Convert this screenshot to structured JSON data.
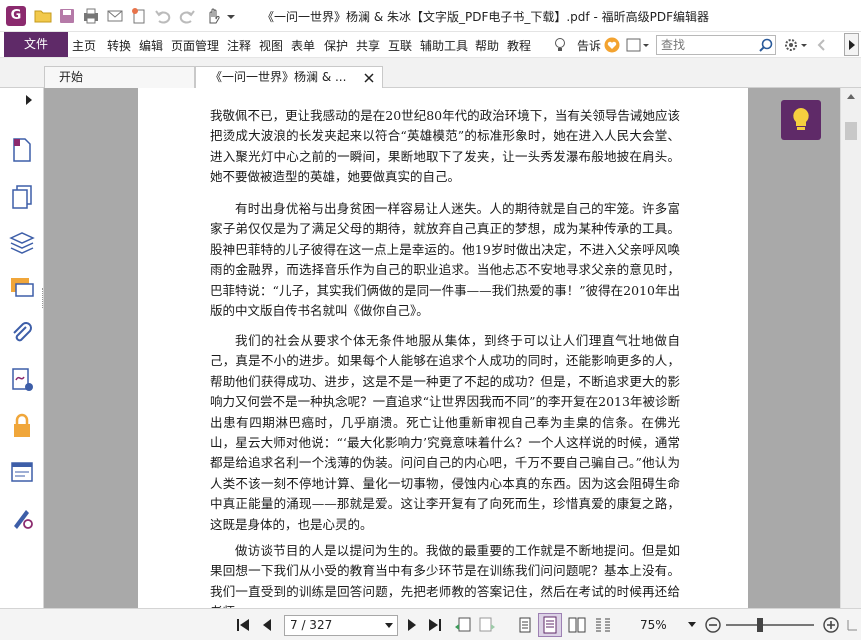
{
  "window": {
    "title": "《一问一世界》杨澜 & 朱冰【文字版_PDF电子书_下载】.pdf - 福昕高级PDF编辑器"
  },
  "menu": {
    "file": "文件",
    "items": [
      "主页",
      "转换",
      "编辑",
      "页面管理",
      "注释",
      "视图",
      "表单",
      "保护",
      "共享",
      "互联",
      "辅助工具",
      "帮助",
      "教程"
    ],
    "tell": "告诉",
    "search_placeholder": "查找"
  },
  "tabs": [
    {
      "label": "开始"
    },
    {
      "label": "《一问一世界》杨澜 & ..."
    }
  ],
  "document": {
    "paragraphs": [
      "我敬佩不已，更让我感动的是在20世纪80年代的政治环境下，当有关领导告诫她应该把烫成大波浪的长发夹起来以符合“英雄模范”的标准形象时，她在进入人民大会堂、进入聚光灯中心之前的一瞬间，果断地取下了发夹，让一头秀发瀑布般地披在肩头。她不要做被造型的英雄，她要做真实的自己。",
      "有时出身优裕与出身贫困一样容易让人迷失。人的期待就是自己的牢笼。许多富家子弟仅仅是为了满足父母的期待，就放弃自己真正的梦想，成为某种传承的工具。股神巴菲特的儿子彼得在这一点上是幸运的。他19岁时做出决定，不进入父亲呼风唤雨的金融界，而选择音乐作为自己的职业追求。当他忐忑不安地寻求父亲的意见时，巴菲特说：“儿子，其实我们俩做的是同一件事——我们热爱的事！”彼得在2010年出版的中文版自传书名就叫《做你自己》。",
      "我们的社会从要求个体无条件地服从集体，到终于可以让人们理直气壮地做自己，真是不小的进步。如果每个人能够在追求个人成功的同时，还能影响更多的人，帮助他们获得成功、进步，这是不是一种更了不起的成功？但是，不断追求更大的影响力又何尝不是一种执念呢？一直追求“让世界因我而不同”的李开复在2013年被诊断出患有四期淋巴癌时，几乎崩溃。死亡让他重新审视自己奉为圭臬的信条。在佛光山，星云大师对他说：“‘最大化影响力’究竟意味着什么？一个人这样说的时候，通常都是给追求名利一个浅薄的伪装。问问自己的内心吧，千万不要自己骗自己。”他认为人类不该一刻不停地计算、量化一切事物，侵蚀内心本真的东西。因为这会阻碍生命中真正能量的涌现——那就是爱。这让李开复有了向死而生，珍惜真爱的康复之路，这既是身体的，也是心灵的。",
      "做访谈节目的人是以提问为生的。我做的最重要的工作就是不断地提问。但是如果回想一下我们从小受的教育当中有多少环节是在训练我们问问题呢？基本上没有。我们一直受到的训练是回答问题，先把老师教的答案记住，然后在考试的时候再还给老师。"
    ]
  },
  "status": {
    "page_indicator": "7 / 327",
    "zoom": "75%"
  },
  "colors": {
    "brand": "#5f2a68",
    "viewer_background": "#a9a9a9"
  },
  "icons": [
    "app-logo-icon",
    "open-icon",
    "save-icon",
    "print-icon",
    "undo-icon",
    "redo-icon",
    "hand-icon",
    "lightbulb-icon",
    "search-icon",
    "gear-icon"
  ]
}
